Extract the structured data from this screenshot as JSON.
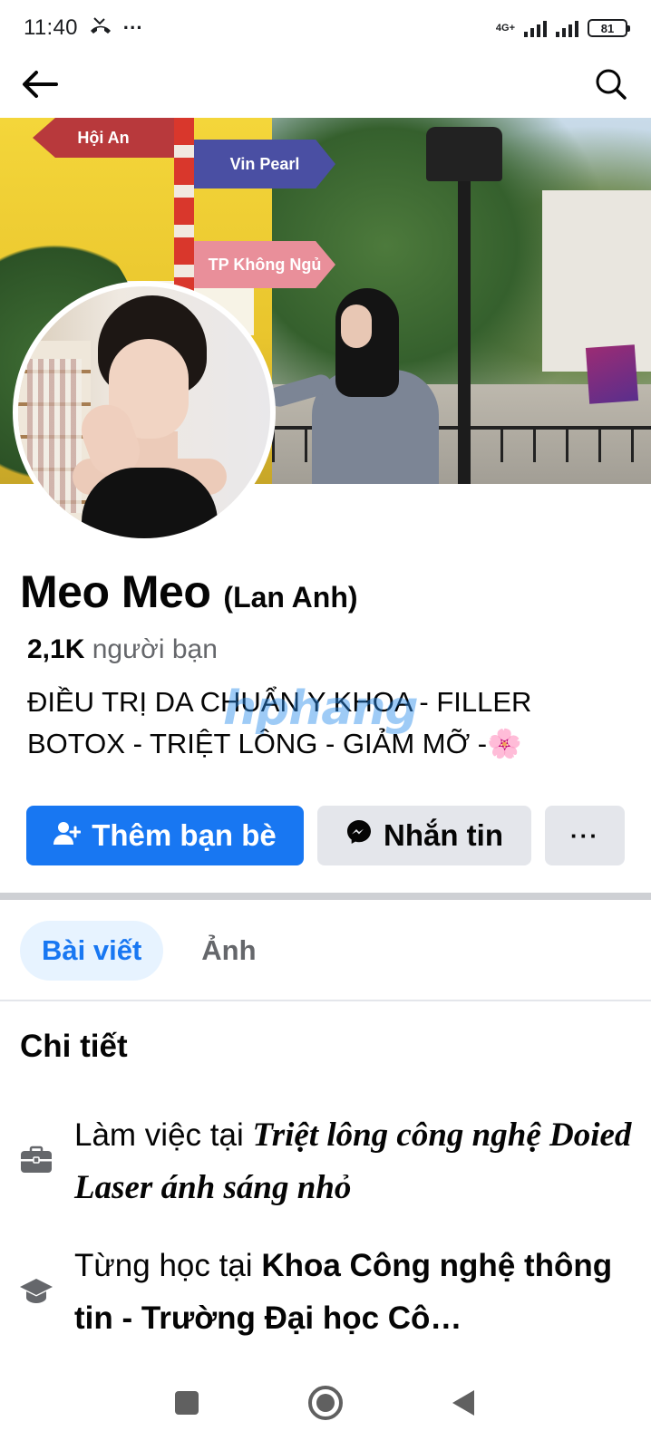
{
  "status_bar": {
    "time": "11:40",
    "more": "···",
    "network": "4G+",
    "battery": "81"
  },
  "profile": {
    "name": "Meo Meo",
    "alt_name": "(Lan Anh)",
    "friends_count": "2,1K",
    "friends_label": "người bạn",
    "bio_line1": "ĐIỀU TRỊ DA CHUẨN Y KHOA - FILLER",
    "bio_line2": "BOTOX - TRIỆT LÔNG - GIẢM MỠ -🌸"
  },
  "cover": {
    "sign_1": "Hội An",
    "sign_2": "Vin Pearl",
    "sign_3": "TP Không Ngủ"
  },
  "watermark": "hphang",
  "actions": {
    "add_friend": "Thêm bạn bè",
    "message": "Nhắn tin",
    "more": "···"
  },
  "tabs": [
    {
      "label": "Bài viết",
      "active": true
    },
    {
      "label": "Ảnh",
      "active": false
    }
  ],
  "details": {
    "title": "Chi tiết",
    "work_prefix": "Làm việc tại ",
    "work_place": "Triệt lông công nghệ Doied Laser ánh sáng nhỏ",
    "edu_prefix": "Từng học tại ",
    "edu_place": "Khoa Công nghệ thông tin - Trường Đại học Cô…"
  },
  "icons": {
    "back": "arrow-left-icon",
    "search": "search-icon",
    "work": "briefcase-icon",
    "education": "graduation-cap-icon",
    "add_friend": "add-person-icon",
    "messenger": "messenger-icon"
  },
  "colors": {
    "primary": "#1877f2",
    "secondary_button": "#e4e6eb",
    "active_tab_bg": "#e7f3ff",
    "text_muted": "#65676b"
  }
}
